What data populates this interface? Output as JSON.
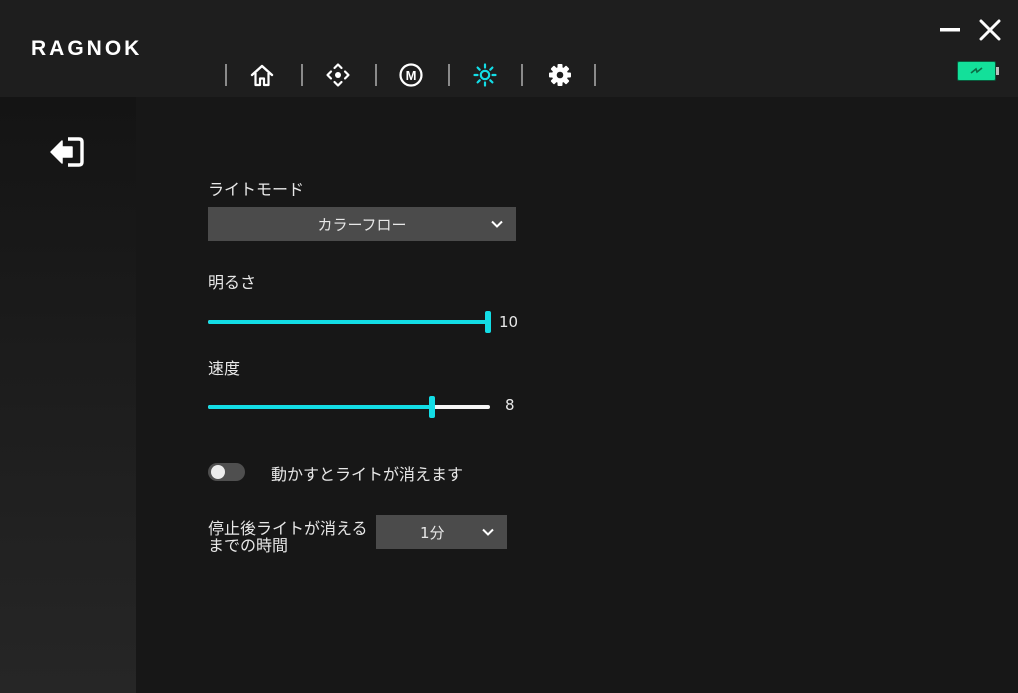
{
  "app": {
    "logo": "RAGNOK"
  },
  "nav": {
    "items": [
      {
        "icon": "home-icon"
      },
      {
        "icon": "dpad-icon"
      },
      {
        "icon": "macro-m-icon",
        "glyph": "M"
      },
      {
        "icon": "light-icon",
        "active": true
      },
      {
        "icon": "gear-icon"
      }
    ],
    "active_color": "#13dde6"
  },
  "battery": {
    "color": "#13e09a"
  },
  "content": {
    "light_mode": {
      "label": "ライトモード",
      "value": "カラーフロー"
    },
    "brightness": {
      "label": "明るさ",
      "value": "10",
      "level": 10,
      "max": 10
    },
    "speed": {
      "label": "速度",
      "value": "8",
      "level": 8,
      "max": 10
    },
    "motion_off": {
      "label": "動かすとライトが消えます",
      "enabled": false
    },
    "idle_timeout": {
      "label_line1": "停止後ライトが消える",
      "label_line2": "までの時間",
      "value": "1分"
    }
  },
  "colors": {
    "accent": "#13dde6",
    "track_off": "#f5f5f5",
    "select_bg": "#4b4b4b"
  }
}
